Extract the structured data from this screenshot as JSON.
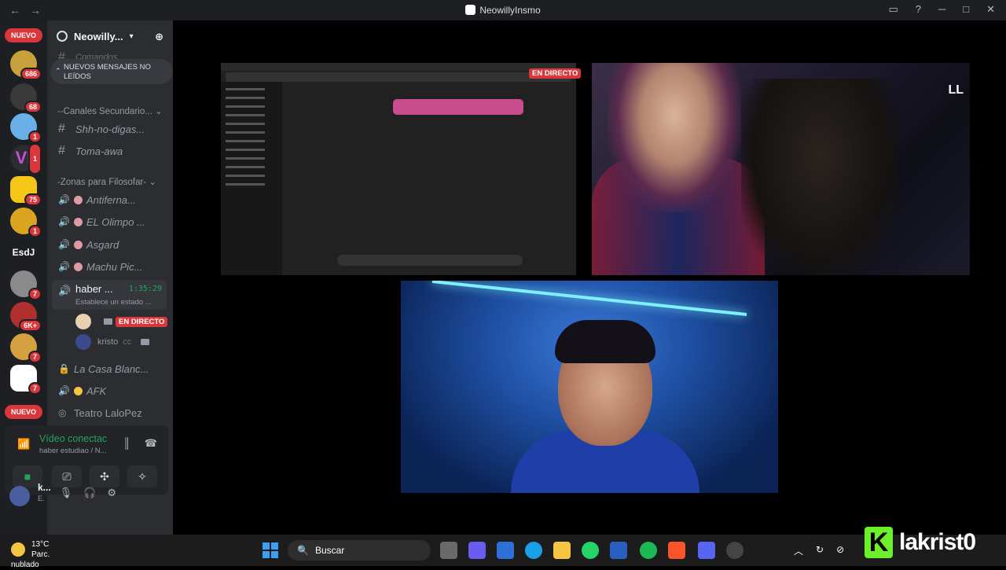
{
  "titlebar": {
    "back": "←",
    "forward": "→",
    "title": "NeowillyInsmo",
    "inbox": "▭",
    "help": "?",
    "minimize": "─",
    "maximize": "□",
    "close": "✕"
  },
  "rail": {
    "new_top": "NUEVO",
    "new_bottom": "NUEVO",
    "text_server": "EsdJ",
    "badges": [
      "686",
      "68",
      "1",
      "1",
      "75",
      "1",
      "7",
      "6K+",
      "7",
      "7"
    ]
  },
  "sidebar": {
    "guild_name": "Neowilly...",
    "partial_channel": "Comandos",
    "new_messages": "NUEVOS MENSAJES NO LEÍDOS",
    "category_secondary": "--Canales Secundario...",
    "channels_secondary": [
      "Shh-no-digas...",
      "Toma-awa"
    ],
    "category_zones": "-Zonas para Filosofar-",
    "voice_channels": [
      "Antiferna...",
      "EL Olimpo ...",
      "Asgard",
      "Machu Pic..."
    ],
    "active_channel": {
      "name": "haber ...",
      "time": "1:35:29",
      "status": "Establece un estado ..."
    },
    "users": [
      {
        "name": "",
        "badge": "EN DIRECTO"
      },
      {
        "name": "kristo",
        "extra": "cc"
      }
    ],
    "more_channels": [
      {
        "name": "La Casa Blanc...",
        "type": "lock"
      },
      {
        "name": "AFK",
        "type": "voice"
      },
      {
        "name": "Teatro LaloPez",
        "type": "stage"
      }
    ]
  },
  "voice_panel": {
    "status": "Vídeo conectac",
    "subtitle": "haber estudiao / N..."
  },
  "user_panel": {
    "name": "k...",
    "sub": "E."
  },
  "stage": {
    "live_badge": "EN DIRECTO",
    "cam_brand": "LL"
  },
  "taskbar": {
    "temperature": "13°C",
    "weather": "Parc. nublado",
    "search": "Buscar"
  },
  "watermark": {
    "k": "K",
    "text": "lakrist0"
  }
}
